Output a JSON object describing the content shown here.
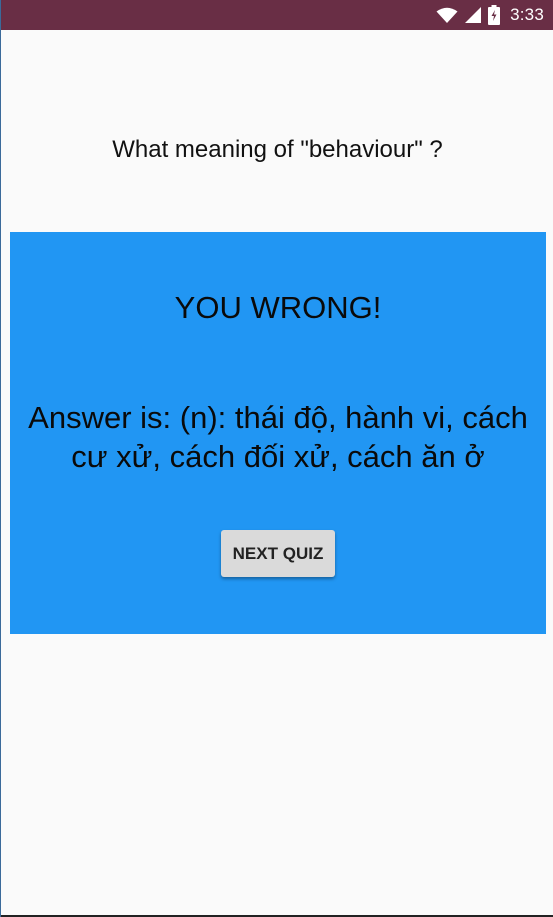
{
  "status_bar": {
    "time": "3:33",
    "icons": [
      "wifi-icon",
      "signal-icon",
      "battery-icon"
    ],
    "background_color": "#692e45"
  },
  "quiz": {
    "question": "What meaning of \"behaviour\" ?",
    "result_title": "YOU WRONG!",
    "answer": "Answer is: (n): thái độ, hành vi, cách cư xử, cách đối xử, cách ăn ở",
    "next_button_label": "NEXT QUIZ",
    "card_color": "#2196f3"
  }
}
